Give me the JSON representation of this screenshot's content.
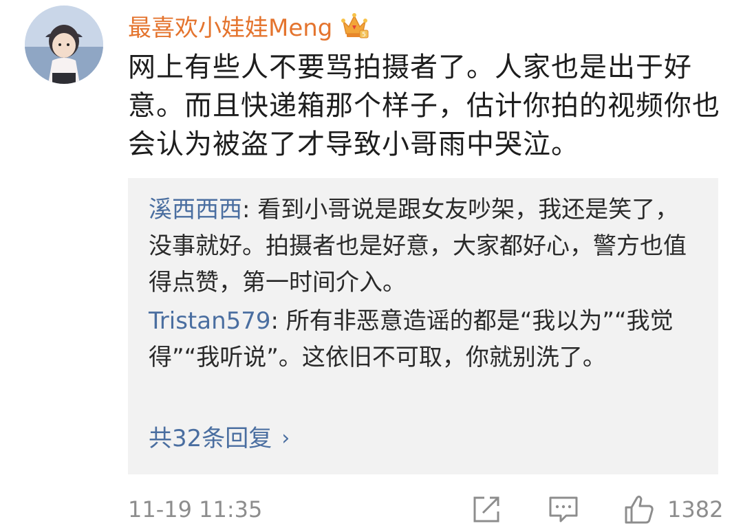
{
  "comment": {
    "username": "最喜欢小娃娃Meng",
    "badge_icon": "vip-crown-icon",
    "text": "网上有些人不要骂拍摄者了。人家也是出于好意。而且快递箱那个样子，估计你拍的视频你也会认为被盗了才导致小哥雨中哭泣。",
    "time": "11-19 11:35",
    "like_count": "1382"
  },
  "replies": [
    {
      "user": "溪西西西",
      "separator": ": ",
      "text": "看到小哥说是跟女友吵架，我还是笑了，没事就好。拍摄者也是好意，大家都好心，警方也值得点赞，第一时间介入。"
    },
    {
      "user": "Tristan579",
      "separator": ": ",
      "text": "所有非恶意造谣的都是“我以为”“我觉得”“我听说”。这依旧不可取，你就别洗了。"
    }
  ],
  "more_replies_label": "共32条回复",
  "more_replies_chevron": "›",
  "colors": {
    "username": "#e4742e",
    "link_blue": "#4a6ea0",
    "reply_bg": "#f2f2f2",
    "meta_gray": "#8d8d8d"
  },
  "icons": {
    "share": "share-icon",
    "comment": "comment-icon",
    "like": "thumbs-up-icon"
  }
}
